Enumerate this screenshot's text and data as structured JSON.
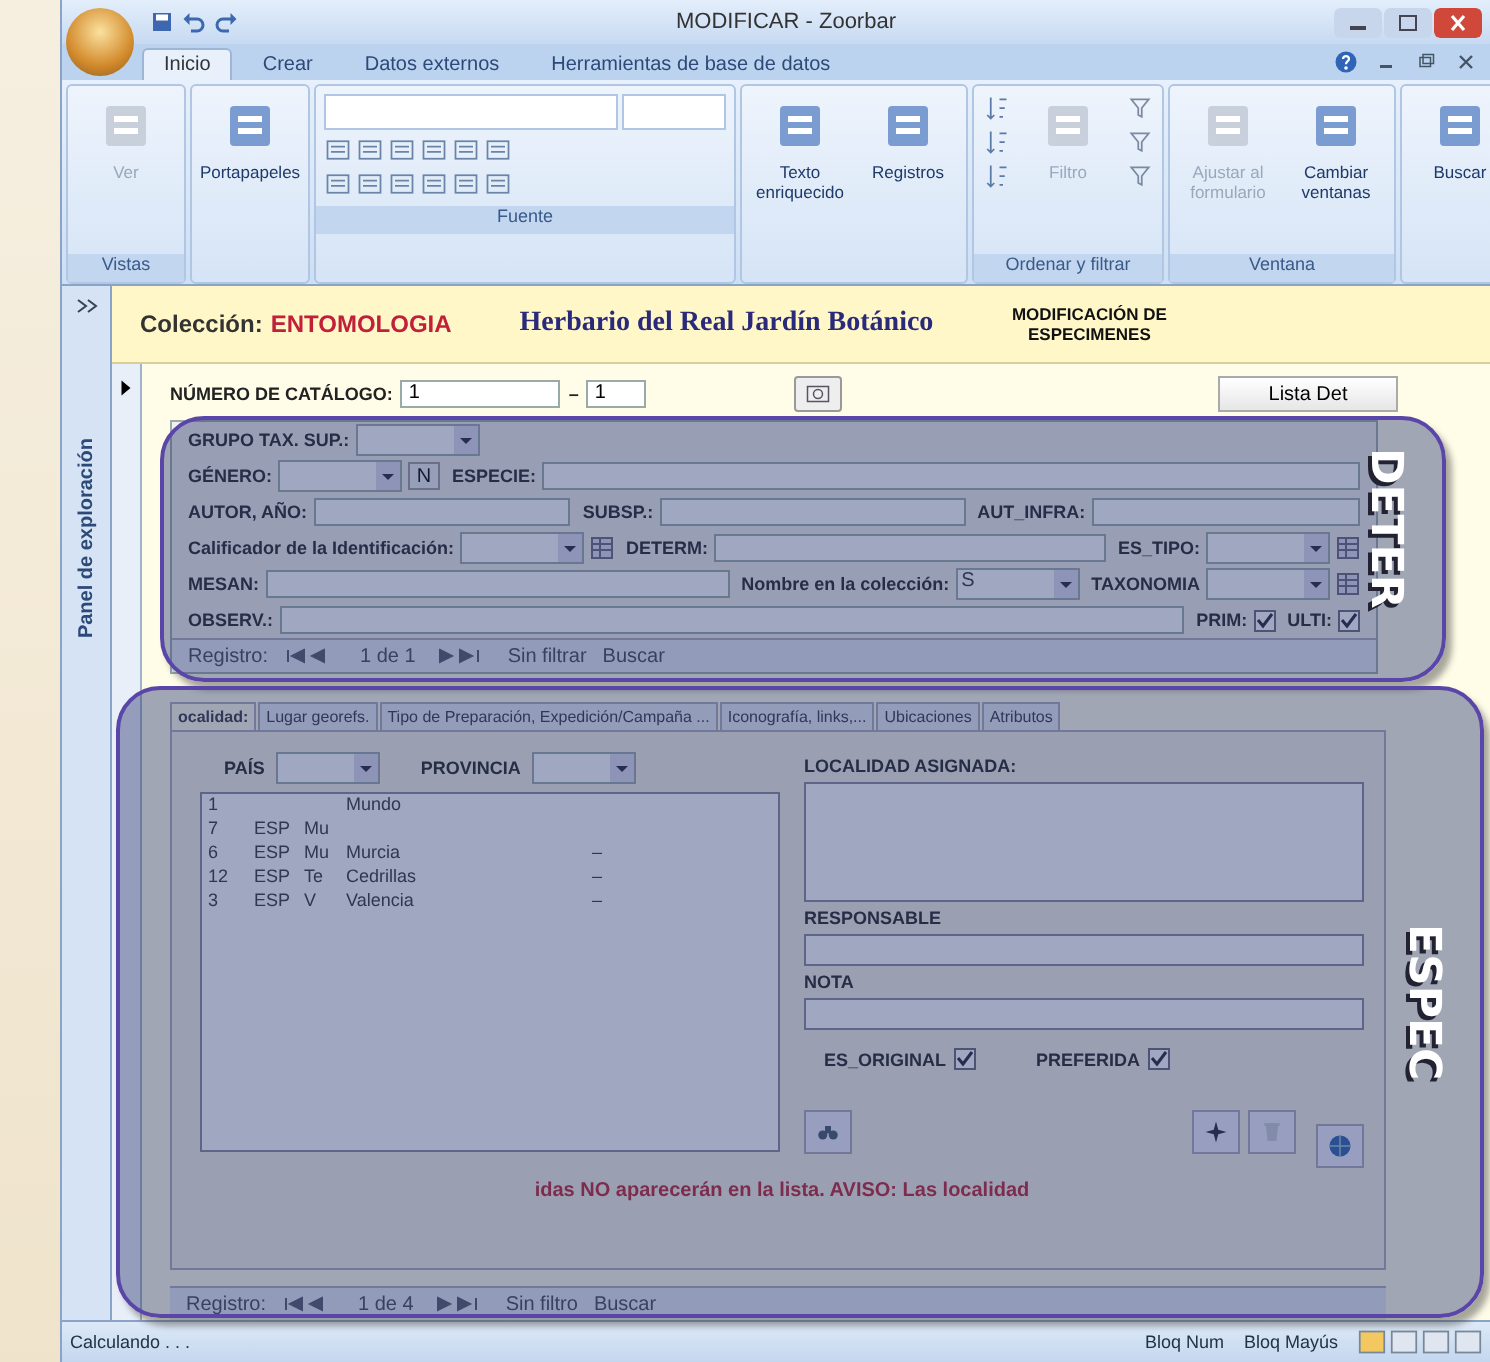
{
  "window": {
    "title": "MODIFICAR - Zoorbar"
  },
  "ribbon_tabs": [
    {
      "label": "Inicio",
      "selected": true
    },
    {
      "label": "Crear",
      "selected": false
    },
    {
      "label": "Datos externos",
      "selected": false
    },
    {
      "label": "Herramientas de base de datos",
      "selected": false
    }
  ],
  "ribbon_groups": [
    {
      "label": "Vistas",
      "kind": "buttons",
      "buttons": [
        {
          "label": "Ver",
          "disabled": true
        }
      ]
    },
    {
      "kind": "buttons",
      "buttons": [
        {
          "label": "Portapapeles",
          "disabled": false
        }
      ]
    },
    {
      "label": "Fuente",
      "kind": "font"
    },
    {
      "kind": "buttons",
      "buttons": [
        {
          "label": "Texto enriquecido",
          "disabled": false
        },
        {
          "label": "Registros",
          "disabled": false
        }
      ]
    },
    {
      "label": "Ordenar y filtrar",
      "kind": "sort",
      "buttons": [
        {
          "label": "Filtro",
          "disabled": true
        }
      ]
    },
    {
      "label": "Ventana",
      "kind": "buttons",
      "buttons": [
        {
          "label": "Ajustar al formulario",
          "disabled": true
        },
        {
          "label": "Cambiar ventanas",
          "disabled": false
        }
      ]
    },
    {
      "kind": "buttons",
      "buttons": [
        {
          "label": "Buscar",
          "disabled": false
        }
      ]
    }
  ],
  "nav_pane": {
    "title": "Panel de exploración"
  },
  "form": {
    "collection_label": "Colección:",
    "collection": "ENTOMOLOGIA",
    "institution": "Herbario del Real Jardín Botánico",
    "form_title": "MODIFICACIÓN DE ESPECIMENES",
    "catalog": {
      "label": "NÚMERO DE CATÁLOGO:",
      "from": "1",
      "separator": "–",
      "to": "1",
      "list_button": "Lista Det"
    }
  },
  "deter": {
    "overlay_label": "DETER",
    "rows": [
      [
        {
          "label": "GRUPO TAX. SUP.:",
          "kind": "combo"
        }
      ],
      [
        {
          "label": "GÉNERO:",
          "kind": "combo_button",
          "button": "N"
        },
        {
          "label": "ESPECIE:",
          "kind": "text"
        }
      ],
      [
        {
          "label": "AUTOR, AÑO:",
          "kind": "text"
        },
        {
          "label": "SUBSP.:",
          "kind": "text"
        },
        {
          "label": "AUT_INFRA:",
          "kind": "text"
        }
      ],
      [
        {
          "label": "Calificador de la Identificación:",
          "kind": "combo_icon"
        },
        {
          "label": "DETERM:",
          "kind": "text"
        },
        {
          "label": "ES_TIPO:",
          "kind": "combo_icon"
        }
      ],
      [
        {
          "label": "MESAN:",
          "kind": "text"
        },
        {
          "label": "Nombre en la colección:",
          "kind": "combo",
          "value": "S"
        },
        {
          "label": "TAXONOMIA",
          "kind": "combo_icon"
        }
      ],
      [
        {
          "label": "OBSERV.:",
          "kind": "text"
        },
        {
          "label": "PRIM:",
          "kind": "check",
          "checked": true
        },
        {
          "label": "ULTI:",
          "kind": "check",
          "checked": true
        }
      ]
    ],
    "navigator": {
      "label": "Registro:",
      "position": "1 de 1",
      "filter": "Sin filtrar",
      "search": "Buscar"
    }
  },
  "espec": {
    "overlay_label": "ESPEC",
    "tabs": [
      {
        "label": "ocalidad:",
        "selected": true
      },
      {
        "label": "Lugar georefs.",
        "selected": false
      },
      {
        "label": "Tipo de Preparación, Expedición/Campaña ...",
        "selected": false
      },
      {
        "label": "Iconografía, links,...",
        "selected": false
      },
      {
        "label": "Ubicaciones",
        "selected": false
      },
      {
        "label": "Atributos",
        "selected": false
      }
    ],
    "country_label": "PAÍS",
    "province_label": "PROVINCIA",
    "places": [
      {
        "id": "1",
        "name": "Mundo"
      },
      {
        "id": "7",
        "country": "ESP",
        "region": "Mu"
      },
      {
        "id": "6",
        "country": "ESP",
        "region": "Mu",
        "name": "Murcia",
        "column_5": "–"
      },
      {
        "id": "12",
        "country": "ESP",
        "region": "Te",
        "name": "Cedrillas",
        "column_5": "–"
      },
      {
        "id": "3",
        "country": "ESP",
        "region": "V",
        "name": "Valencia",
        "column_5": "–"
      }
    ],
    "assigned_label": "LOCALIDAD ASIGNADA:",
    "responsible_label": "RESPONSABLE",
    "note_label": "NOTA",
    "checks": [
      {
        "label": "ES_ORIGINAL",
        "checked": true
      },
      {
        "label": "PREFERIDA",
        "checked": true
      }
    ],
    "warning": "idas NO aparecerán en la lista. AVISO: Las localidad",
    "navigator": {
      "label": "Registro:",
      "position": "1 de 4",
      "filter": "Sin filtro",
      "search": "Buscar"
    }
  },
  "status_bar": {
    "message": "Calculando . . .",
    "indicators": [
      "Bloq Num",
      "Bloq Mayús"
    ]
  }
}
